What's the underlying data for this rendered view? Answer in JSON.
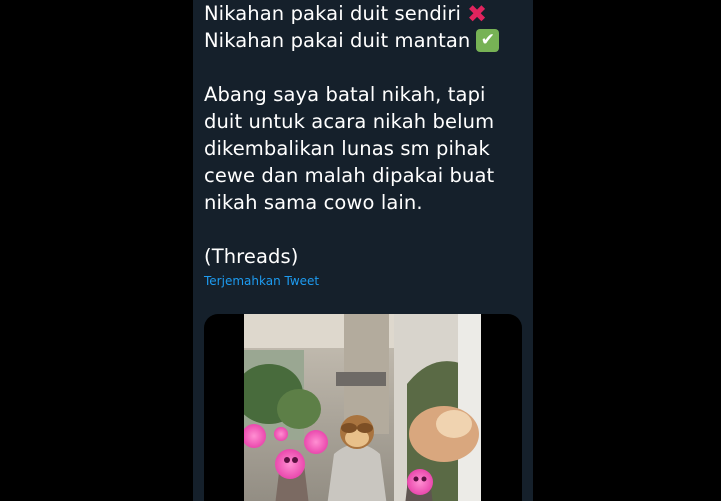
{
  "tweet": {
    "lines": {
      "l1": "Nikahan pakai duit sendiri",
      "l2": "Nikahan pakai duit mantan",
      "p1": "Abang saya batal nikah, tapi",
      "p2": "duit untuk acara nikah belum",
      "p3": "dikembalikan lunas sm pihak",
      "p4": "cewe dan malah dipakai buat",
      "p5": "nikah sama cowo lain.",
      "p6": "(Threads)"
    },
    "icons": {
      "cross": "cross-mark-emoji",
      "check": "check-mark-button-emoji"
    },
    "translate_label": "Terjemahkan Tweet",
    "media": {
      "icon": "photo",
      "stickers": [
        "heart-eyes-emoji",
        "monkey-covering-eyes-emoji"
      ]
    }
  },
  "colors": {
    "background": "#000000",
    "panel": "#15202b",
    "text": "#ffffff",
    "link": "#1d9bf0",
    "cross": "#e0245e",
    "check": "#77b255"
  }
}
